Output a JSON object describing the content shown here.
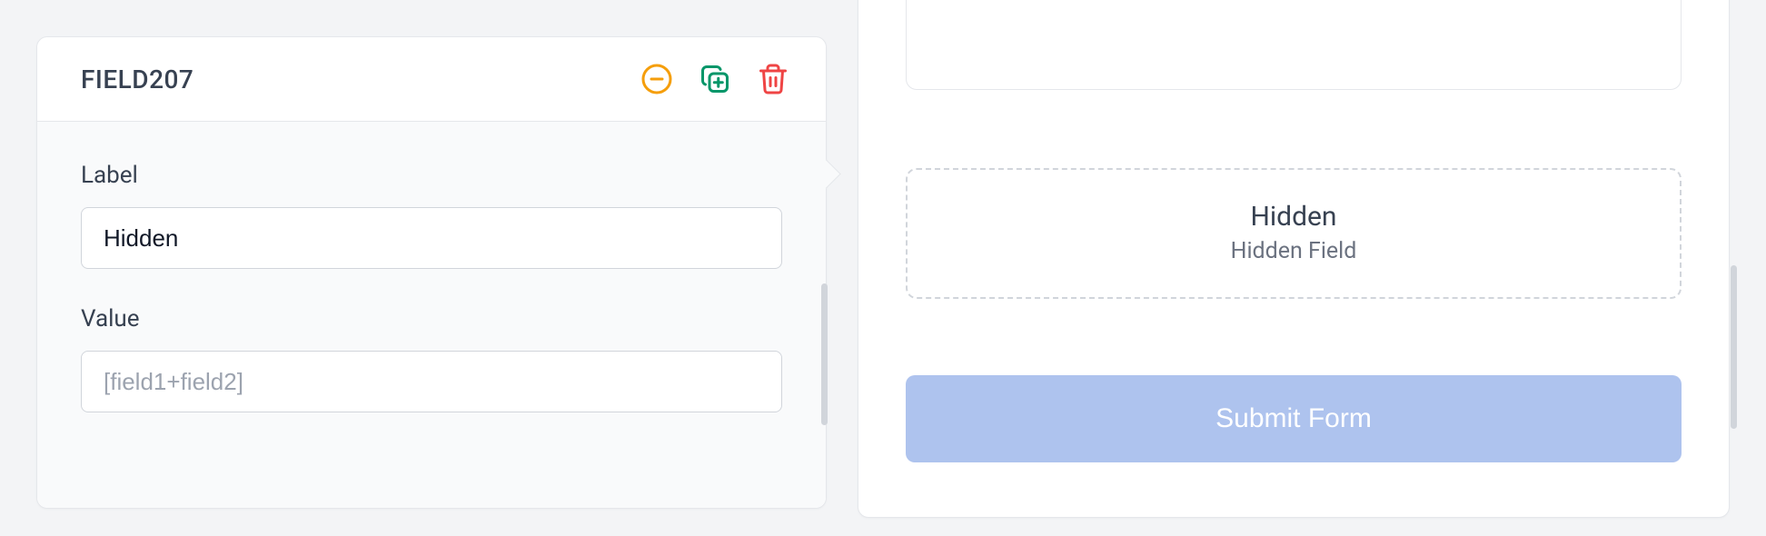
{
  "editor": {
    "field_id": "FIELD207",
    "actions": {
      "collapse": "collapse",
      "duplicate": "duplicate",
      "delete": "delete"
    },
    "label": {
      "caption": "Label",
      "value": "Hidden"
    },
    "value": {
      "caption": "Value",
      "value": "",
      "placeholder": "[field1+field2]"
    }
  },
  "preview": {
    "hidden": {
      "title": "Hidden",
      "subtitle": "Hidden Field"
    },
    "submit_label": "Submit Form"
  }
}
